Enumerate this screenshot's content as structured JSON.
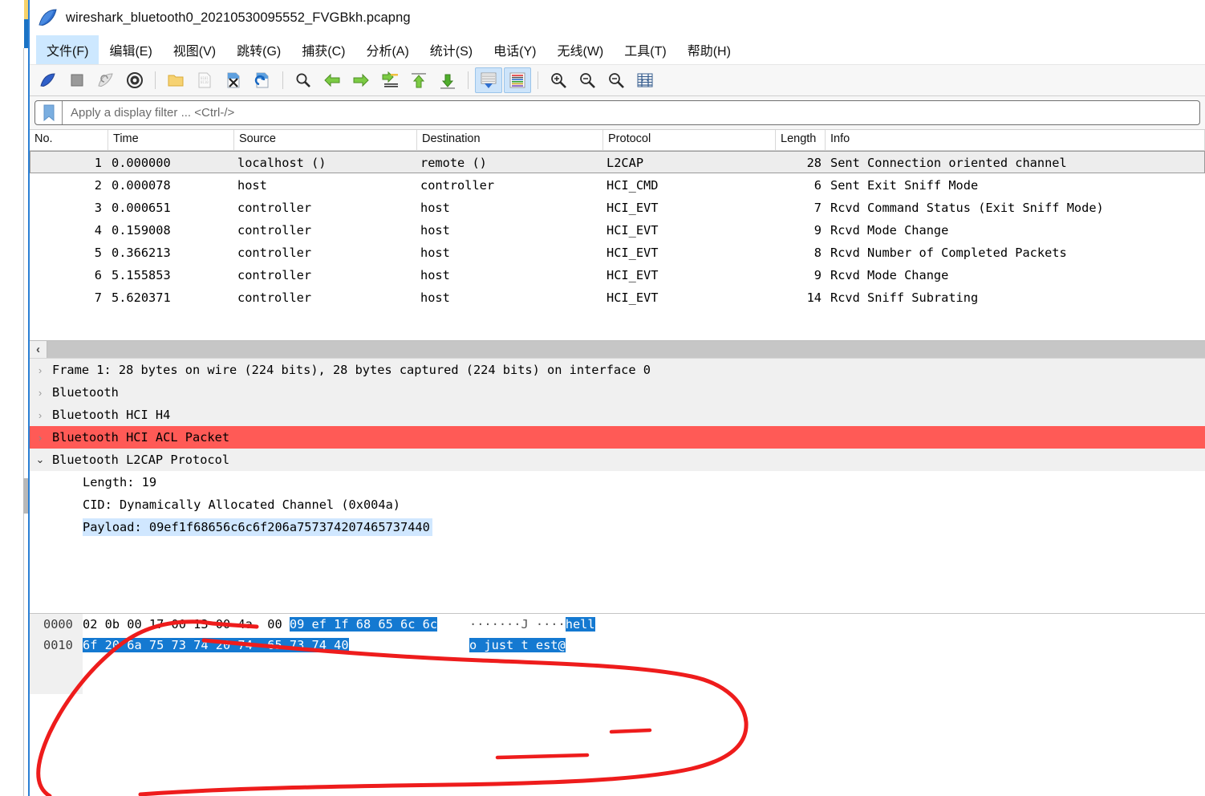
{
  "window": {
    "title": "wireshark_bluetooth0_20210530095552_FVGBkh.pcapng",
    "app_icon": "wireshark-fin-icon"
  },
  "menu": {
    "items": [
      {
        "label": "文件(F)",
        "name": "menu-file",
        "active": true
      },
      {
        "label": "编辑(E)",
        "name": "menu-edit",
        "active": false
      },
      {
        "label": "视图(V)",
        "name": "menu-view",
        "active": false
      },
      {
        "label": "跳转(G)",
        "name": "menu-go",
        "active": false
      },
      {
        "label": "捕获(C)",
        "name": "menu-capture",
        "active": false
      },
      {
        "label": "分析(A)",
        "name": "menu-analyze",
        "active": false
      },
      {
        "label": "统计(S)",
        "name": "menu-statistics",
        "active": false
      },
      {
        "label": "电话(Y)",
        "name": "menu-telephony",
        "active": false
      },
      {
        "label": "无线(W)",
        "name": "menu-wireless",
        "active": false
      },
      {
        "label": "工具(T)",
        "name": "menu-tools",
        "active": false
      },
      {
        "label": "帮助(H)",
        "name": "menu-help",
        "active": false
      }
    ]
  },
  "toolbar": {
    "buttons": [
      "start-capture-icon",
      "stop-capture-icon",
      "restart-capture-icon",
      "capture-options-icon",
      "open-file-icon",
      "save-file-icon",
      "close-file-icon",
      "reload-file-icon",
      "find-packet-icon",
      "go-back-icon",
      "go-forward-icon",
      "go-to-packet-icon",
      "go-to-first-icon",
      "go-to-last-icon",
      "auto-scroll-icon",
      "colorize-icon",
      "zoom-in-icon",
      "zoom-out-icon",
      "zoom-reset-icon",
      "resize-columns-icon"
    ]
  },
  "filter": {
    "placeholder": "Apply a display filter ... <Ctrl-/>",
    "value": "",
    "bookmark_icon": "bookmark-icon"
  },
  "packet_list": {
    "columns": [
      "No.",
      "Time",
      "Source",
      "Destination",
      "Protocol",
      "Length",
      "Info"
    ],
    "rows": [
      {
        "no": "1",
        "time": "0.000000",
        "source": "localhost ()",
        "destination": "remote ()",
        "protocol": "L2CAP",
        "length": "28",
        "info": "Sent Connection oriented channel",
        "selected": true
      },
      {
        "no": "2",
        "time": "0.000078",
        "source": "host",
        "destination": "controller",
        "protocol": "HCI_CMD",
        "length": "6",
        "info": "Sent Exit Sniff Mode",
        "selected": false
      },
      {
        "no": "3",
        "time": "0.000651",
        "source": "controller",
        "destination": "host",
        "protocol": "HCI_EVT",
        "length": "7",
        "info": "Rcvd Command Status (Exit Sniff Mode)",
        "selected": false
      },
      {
        "no": "4",
        "time": "0.159008",
        "source": "controller",
        "destination": "host",
        "protocol": "HCI_EVT",
        "length": "9",
        "info": "Rcvd Mode Change",
        "selected": false
      },
      {
        "no": "5",
        "time": "0.366213",
        "source": "controller",
        "destination": "host",
        "protocol": "HCI_EVT",
        "length": "8",
        "info": "Rcvd Number of Completed Packets",
        "selected": false
      },
      {
        "no": "6",
        "time": "5.155853",
        "source": "controller",
        "destination": "host",
        "protocol": "HCI_EVT",
        "length": "9",
        "info": "Rcvd Mode Change",
        "selected": false
      },
      {
        "no": "7",
        "time": "5.620371",
        "source": "controller",
        "destination": "host",
        "protocol": "HCI_EVT",
        "length": "14",
        "info": "Rcvd Sniff Subrating",
        "selected": false
      }
    ]
  },
  "scrollbar": {
    "left_arrow": "‹"
  },
  "detail_tree": {
    "rows": [
      {
        "label": "Frame 1: 28 bytes on wire (224 bits), 28 bytes captured (224 bits) on interface 0",
        "level": 0,
        "state": "collapsed",
        "twisty": "›",
        "style": "normal"
      },
      {
        "label": "Bluetooth",
        "level": 0,
        "state": "collapsed",
        "twisty": "›",
        "style": "normal"
      },
      {
        "label": "Bluetooth HCI H4",
        "level": 0,
        "state": "collapsed",
        "twisty": "›",
        "style": "normal"
      },
      {
        "label": "Bluetooth HCI ACL Packet",
        "level": 0,
        "state": "collapsed",
        "twisty": "›",
        "style": "danger"
      },
      {
        "label": "Bluetooth L2CAP Protocol",
        "level": 0,
        "state": "expanded",
        "twisty": "⌄",
        "style": "normal"
      },
      {
        "label": "Length: 19",
        "level": 1,
        "state": "leaf",
        "twisty": "",
        "style": "child"
      },
      {
        "label": "CID: Dynamically Allocated Channel (0x004a)",
        "level": 1,
        "state": "leaf",
        "twisty": "",
        "style": "child"
      },
      {
        "label": "Payload: 09ef1f68656c6c6f206a757374207465737440",
        "level": 1,
        "state": "leaf",
        "twisty": "",
        "style": "child-highlight"
      }
    ]
  },
  "hex_dump": {
    "rows": [
      {
        "offset": "0000",
        "bytes_plain": "02 0b 00 17 00 13 00 4a  00 ",
        "bytes_selected": "09 ef 1f 68 65 6c 6c",
        "ascii_plain": "·······J ····",
        "ascii_selected": "hell"
      },
      {
        "offset": "0010",
        "bytes_plain": "",
        "bytes_selected": "6f 20 6a 75 73 74 20 74  65 73 74 40",
        "ascii_plain": "",
        "ascii_selected": "o just t est@"
      }
    ]
  },
  "annotation": {
    "type": "hand-drawn-red-circle",
    "color": "#ee1c1c",
    "strokes": [
      "circle-around-hex-dump",
      "underline-hell",
      "underline-est"
    ]
  },
  "colors": {
    "selected_row": "#ededed",
    "danger_row": "#ff5a56",
    "payload_highlight": "#d0e7ff",
    "hex_selection": "#1479d1",
    "menu_active": "#cde8ff",
    "toolbar_toggled": "#cde4fa",
    "annotation_red": "#ee1c1c"
  }
}
